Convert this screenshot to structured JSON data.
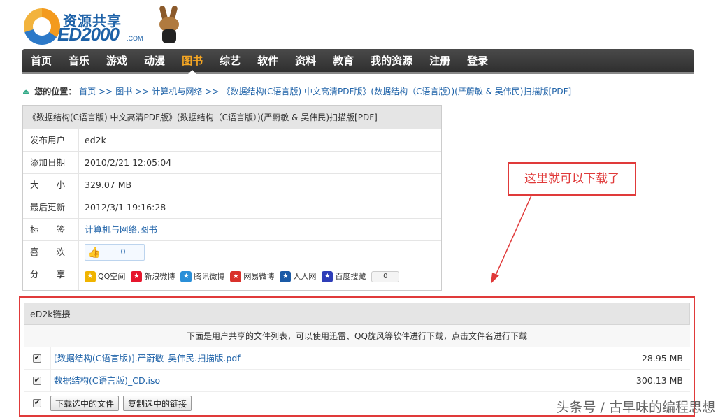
{
  "logo": {
    "cn_text": "资源共享",
    "en_text": "ED2000",
    "domain_text": ".COM"
  },
  "top_corner_text": "—",
  "nav": {
    "items": [
      "首页",
      "音乐",
      "游戏",
      "动漫",
      "图书",
      "综艺",
      "软件",
      "资料",
      "教育",
      "我的资源",
      "注册",
      "登录"
    ],
    "active_index": 4
  },
  "breadcrumb": {
    "label": "您的位置：",
    "items": [
      "首页",
      "图书",
      "计算机与网络",
      "《数据结构(C语言版) 中文高清PDF版》(数据结构（C语言版）)(严蔚敏 & 吴伟民)扫描版[PDF]"
    ],
    "separator": ">>"
  },
  "info": {
    "title": "《数据结构(C语言版) 中文高清PDF版》(数据结构（C语言版）)(严蔚敏 & 吴伟民)扫描版[PDF]",
    "rows": [
      {
        "key": "发布用户",
        "value": "ed2k"
      },
      {
        "key": "添加日期",
        "value": "2010/2/21 12:05:04"
      },
      {
        "key": "大　　小",
        "value": "329.07 MB"
      },
      {
        "key": "最后更新",
        "value": "2012/3/1 19:16:28"
      },
      {
        "key": "标　　签",
        "value": "计算机与网络,图书"
      },
      {
        "key": "喜　　欢",
        "value": "0"
      },
      {
        "key": "分　　享",
        "value": ""
      }
    ],
    "share": [
      {
        "label": "QQ空间",
        "color": "#f0b400",
        "icon": "qzone-icon"
      },
      {
        "label": "新浪微博",
        "color": "#e6162d",
        "icon": "weibo-icon"
      },
      {
        "label": "腾讯微博",
        "color": "#2a8fd8",
        "icon": "tencent-weibo-icon"
      },
      {
        "label": "网易微博",
        "color": "#d9312b",
        "icon": "netease-weibo-icon"
      },
      {
        "label": "人人网",
        "color": "#1a5aa6",
        "icon": "renren-icon"
      },
      {
        "label": "百度搜藏",
        "color": "#2f3eb8",
        "icon": "baidu-icon"
      }
    ],
    "share_count": "0"
  },
  "callout": {
    "text": "这里就可以下载了",
    "color": "#e03a3a"
  },
  "ed2k": {
    "title": "eD2k链接",
    "description": "下面是用户共享的文件列表，可以使用迅雷、QQ旋风等软件进行下载，点击文件名进行下载",
    "files": [
      {
        "name": "[数据结构(C语言版)].严蔚敏_吴伟民.扫描版.pdf",
        "size": "28.95 MB",
        "checked": true
      },
      {
        "name": "数据结构(C语言版)_CD.iso",
        "size": "300.13 MB",
        "checked": true
      }
    ],
    "select_all_checked": true,
    "download_button": "下载选中的文件",
    "copy_button": "复制选中的链接"
  },
  "watermark": "头条号 / 古早味的编程思想"
}
